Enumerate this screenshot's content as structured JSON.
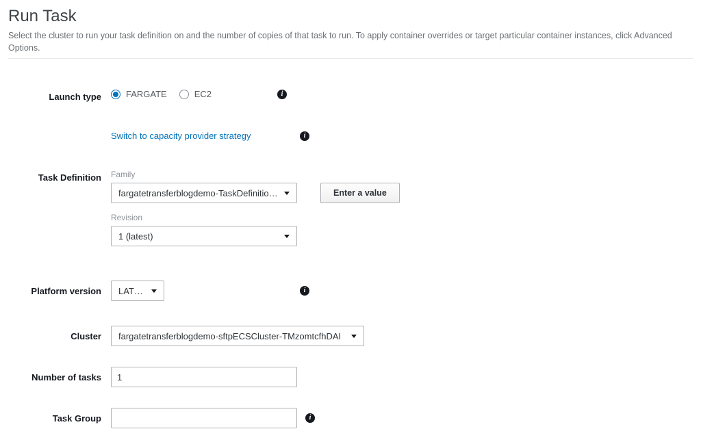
{
  "page": {
    "title": "Run Task",
    "description": "Select the cluster to run your task definition on and the number of copies of that task to run. To apply container overrides or target particular container instances, click Advanced Options."
  },
  "launch_type": {
    "label": "Launch type",
    "options": {
      "fargate": "FARGATE",
      "ec2": "EC2"
    },
    "switch_link": "Switch to capacity provider strategy"
  },
  "task_definition": {
    "label": "Task Definition",
    "family_label": "Family",
    "family_value": "fargatetransferblogdemo-TaskDefinition-E…",
    "revision_label": "Revision",
    "revision_value": "1 (latest)",
    "enter_value_btn": "Enter a value"
  },
  "platform_version": {
    "label": "Platform version",
    "value": "LATEST"
  },
  "cluster": {
    "label": "Cluster",
    "value": "fargatetransferblogdemo-sftpECSCluster-TMzomtcfhDAI"
  },
  "number_of_tasks": {
    "label": "Number of tasks",
    "value": "1"
  },
  "task_group": {
    "label": "Task Group",
    "value": ""
  }
}
